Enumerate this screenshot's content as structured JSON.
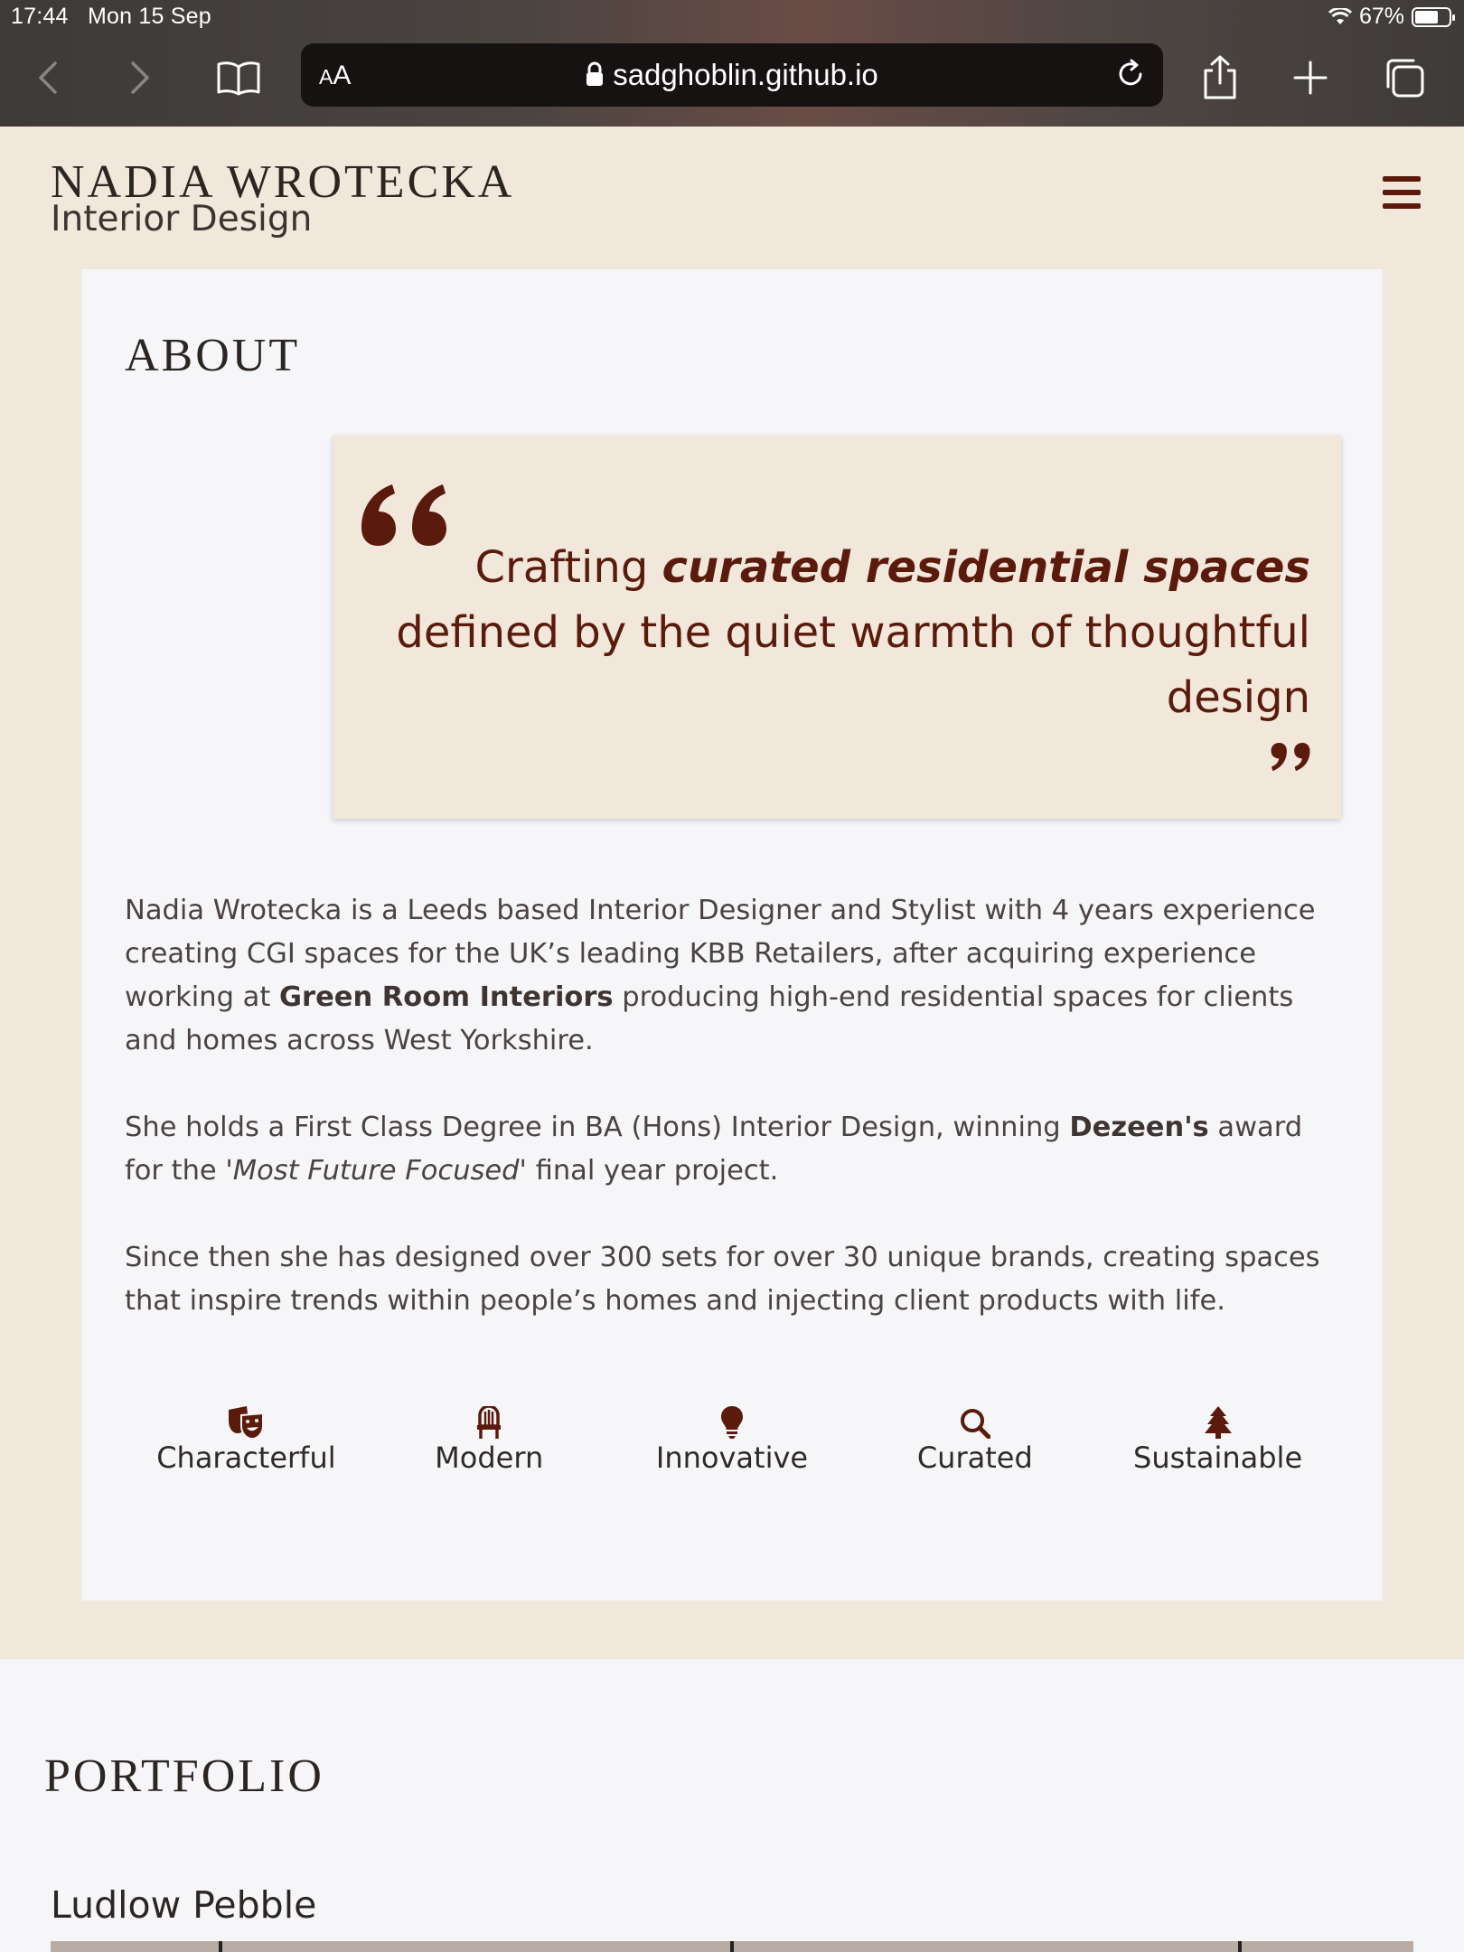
{
  "status_bar": {
    "time": "17:44",
    "date": "Mon 15 Sep",
    "battery": "67%",
    "battery_level": 0.67
  },
  "browser": {
    "url": "sadghoblin.github.io",
    "text_size_label": "AA",
    "icons": [
      "back-icon",
      "forward-icon",
      "bookmarks-icon",
      "lock-icon",
      "reload-icon",
      "share-icon",
      "new-tab-icon",
      "tabs-icon"
    ]
  },
  "site": {
    "brand_name": "NADIA WROTECKA",
    "brand_sub": "Interior Design",
    "menu_icon": "hamburger-menu-icon",
    "accent_color": "#5a1a0c",
    "band_color": "#f1e7da"
  },
  "about": {
    "title": "ABOUT",
    "quote": {
      "part1": "Crafting ",
      "emphasis": "curated residential spaces",
      "part2": " defined by the quiet warmth of thoughtful design"
    },
    "paragraphs": [
      {
        "p1_a": "Nadia Wrotecka is a Leeds based Interior Designer and Stylist with 4 years experience creating CGI spaces for the UK’s leading KBB Retailers, after acquiring experience working at ",
        "p1_b": "Green Room Interiors",
        "p1_c": " producing high-end residential spaces for clients and homes across West Yorkshire."
      },
      {
        "p2_a": "She holds a First Class Degree in BA (Hons) Interior Design, winning ",
        "p2_b": "Dezeen's",
        "p2_c": " award for the ",
        "p2_d": "'Most Future Focused'",
        "p2_e": " final year project."
      },
      {
        "p3": "Since then she has designed over 300 sets for over 30 unique brands, creating spaces that inspire trends within people’s homes and injecting client products with life."
      }
    ],
    "values": [
      {
        "label": "Characterful",
        "icon": "theater-masks-icon"
      },
      {
        "label": "Modern",
        "icon": "chair-icon"
      },
      {
        "label": "Innovative",
        "icon": "lightbulb-icon"
      },
      {
        "label": "Curated",
        "icon": "search-icon"
      },
      {
        "label": "Sustainable",
        "icon": "tree-icon"
      }
    ]
  },
  "portfolio": {
    "title": "PORTFOLIO",
    "project_title": "Ludlow Pebble"
  }
}
